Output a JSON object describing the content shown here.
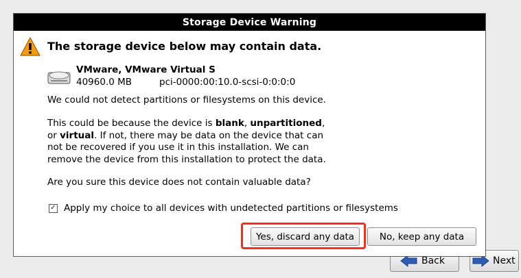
{
  "dialog": {
    "title": "Storage Device Warning",
    "headline": "The storage device below may contain data.",
    "device": {
      "name": "VMware, VMware Virtual S",
      "size": "40960.0 MB",
      "path": "pci-0000:00:10.0-scsi-0:0:0:0"
    },
    "para1": "We could not detect partitions or filesystems on this device.",
    "para2": {
      "l1a": "This could be because the device is ",
      "l1b": "blank",
      "l1c": ", ",
      "l1d": "unpartitioned",
      "l1e": ",",
      "l2a": "or ",
      "l2b": "virtual",
      "l2c": ". If not, there may be data on the device that can",
      "l3": "not be recovered if you use it in this installation. We can",
      "l4": "remove the device from this installation to protect the data."
    },
    "para3": "Are you sure this device does not contain valuable data?",
    "checkbox": {
      "label": "Apply my choice to all devices with undetected partitions or filesystems",
      "checked": true,
      "mark": "✓"
    },
    "yes_label": "Yes, discard any data",
    "no_label": "No, keep any data"
  },
  "nav": {
    "back_label": "Back",
    "next_label": "Next"
  },
  "colors": {
    "titlebar": "#000000",
    "highlight": "#ff2a1a",
    "warning": "#f39c12",
    "nav_arrow": "#2c5fb3"
  },
  "icons": [
    "warning-icon",
    "hard-disk-icon",
    "back-arrow-icon",
    "next-arrow-icon",
    "checkmark-icon"
  ]
}
